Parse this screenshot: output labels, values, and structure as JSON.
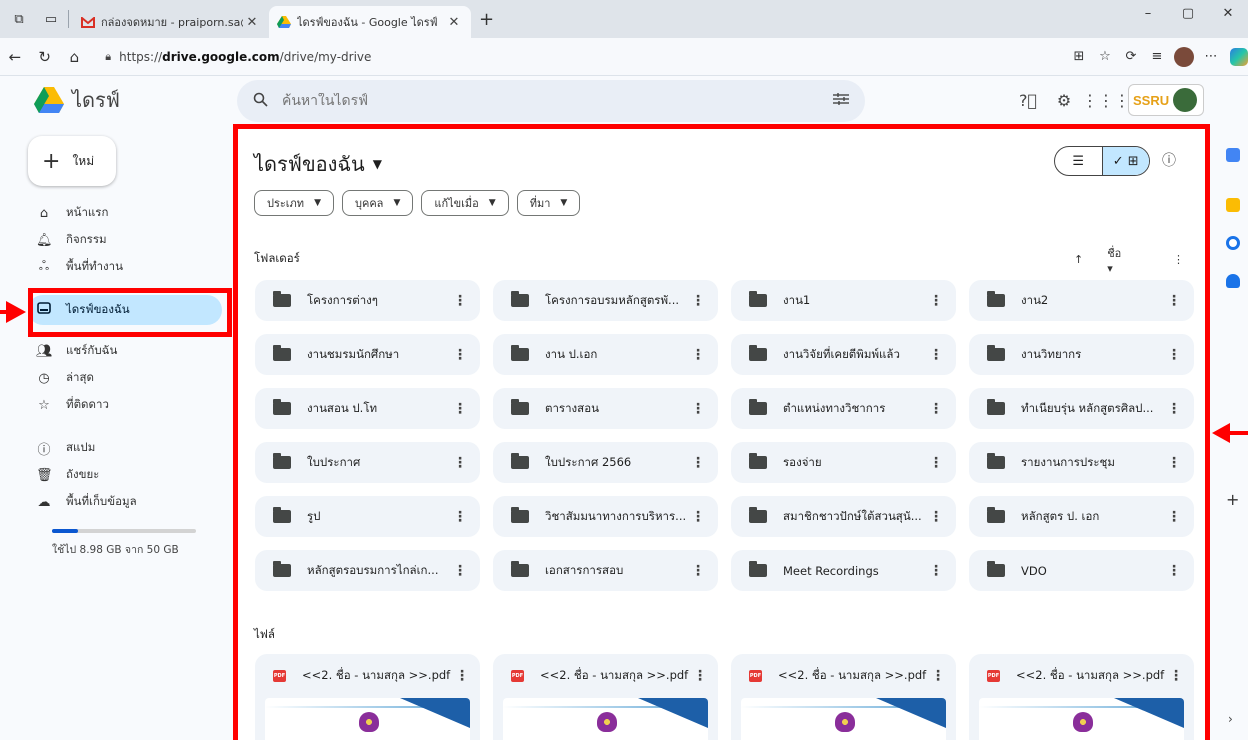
{
  "browser": {
    "tabs": [
      {
        "label": "กล่องจดหมาย - praiporn.sa@ssru.a",
        "active": false
      },
      {
        "label": "ไดรฟ์ของฉัน - Google ไดรฟ์",
        "active": true
      }
    ],
    "url_prefix": "https://",
    "url_host": "drive.google.com",
    "url_path": "/drive/my-drive",
    "window_controls": {
      "minimize": "–",
      "restore": "▢",
      "close": "✕"
    }
  },
  "header": {
    "app_name": "ไดรฟ์",
    "search_placeholder": "ค้นหาในไดรฟ์",
    "brand_logo_text": "SSRU"
  },
  "sidebar": {
    "new_label": "ใหม่",
    "items": [
      {
        "label": "หน้าแรก",
        "icon": "home-icon"
      },
      {
        "label": "กิจกรรม",
        "icon": "bell-icon"
      },
      {
        "label": "พื้นที่ทำงาน",
        "icon": "workspace-icon"
      },
      {
        "label": "ไดรฟ์ของฉัน",
        "icon": "drive-icon",
        "active": true
      },
      {
        "label": "แชร์กับฉัน",
        "icon": "people-icon"
      },
      {
        "label": "ล่าสุด",
        "icon": "clock-icon"
      },
      {
        "label": "ที่ติดดาว",
        "icon": "star-icon"
      },
      {
        "label": "สแปม",
        "icon": "spam-icon"
      },
      {
        "label": "ถังขยะ",
        "icon": "trash-icon"
      },
      {
        "label": "พื้นที่เก็บข้อมูล",
        "icon": "cloud-icon"
      }
    ],
    "storage_used_fraction": 0.18,
    "storage_text": "ใช้ไป 8.98 GB จาก 50 GB"
  },
  "main": {
    "title": "ไดรฟ์ของฉัน",
    "filters": [
      "ประเภท",
      "บุคคล",
      "แก้ไขเมื่อ",
      "ที่มา"
    ],
    "folders_label": "โฟลเดอร์",
    "sort_label": "ชื่อ",
    "folders": [
      "โครงการต่างๆ",
      "โครงการอบรมหลักสูตรพั...",
      "งาน1",
      "งาน2",
      "งานชมรมนักศึกษา",
      "งาน ป.เอก",
      "งานวิจัยที่เคยตีพิมพ์แล้ว",
      "งานวิทยากร",
      "งานสอน ป.โท",
      "ตารางสอน",
      "ตำแหน่งทางวิชาการ",
      "ทำเนียบรุ่น หลักสูตรศิลป...",
      "ใบประกาศ",
      "ใบประกาศ 2566",
      "รองจ่าย",
      "รายงานการประชุม",
      "รูป",
      "วิชาสัมมนาทางการบริหาร...",
      "สมาชิกชาวปักษ์ใต้สวนสุนั...",
      "หลักสูตร ป. เอก",
      "หลักสูตรอบรมการไกล่เก...",
      "เอกสารการสอบ",
      "Meet Recordings",
      "VDO"
    ],
    "files_label": "ไฟล์",
    "files": [
      "<<2. ชื่อ - นามสกุล >>.pdf",
      "<<2. ชื่อ - นามสกุล >>.pdf",
      "<<2. ชื่อ - นามสกุล >>.pdf",
      "<<2. ชื่อ - นามสกุล >>.pdf"
    ]
  },
  "colors": {
    "annotation_red": "#ff0000",
    "active_nav": "#c2e7ff",
    "folder_card": "#f0f4f9",
    "storage_fill": "#0b57d0"
  }
}
